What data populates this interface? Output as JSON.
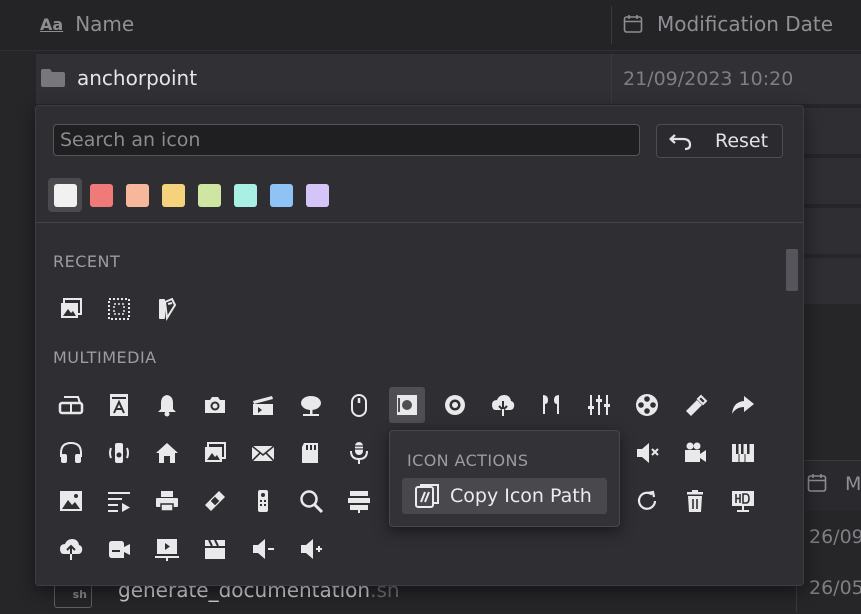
{
  "table": {
    "col_name": "Name",
    "col_date": "Modification Date",
    "name_icon_glyph": "Aa",
    "rows": [
      {
        "name": "anchorpoint",
        "date": "21/09/2023 10:20"
      }
    ],
    "side_header_letter": "M",
    "side_dates": [
      "26/09",
      "26/05"
    ],
    "bottom_file": {
      "name": "generate_documentation",
      "ext": ".sh",
      "badge": "sh"
    }
  },
  "picker": {
    "search_placeholder": "Search an icon",
    "reset_label": "Reset",
    "colors": [
      "#f1f1f1",
      "#f07a7a",
      "#f6b79a",
      "#f5d27c",
      "#cfe6a2",
      "#a9efe4",
      "#8fc3f5",
      "#d5c4f7"
    ],
    "selected_color_index": 0,
    "recent_label": "RECENT",
    "multimedia_label": "MULTIMEDIA",
    "recent_icons": [
      "image-stack-icon",
      "dotted-square-icon",
      "swatch-book-icon"
    ],
    "multimedia_rows": [
      [
        "vr-glasses-icon",
        "font-file-icon",
        "bell-icon",
        "camera-icon",
        "clapperboard-icon",
        "tree-icon",
        "mouse-icon",
        "photo-frame-icon",
        "disc-icon",
        "cloud-download-icon",
        "airpods-icon",
        "equalizer-icon",
        "film-reel-icon",
        "usb-stick-icon",
        "share-arrow-icon"
      ],
      [
        "headphones-icon",
        "speaker-icon",
        "home-icon",
        "image-stack-icon",
        "mail-icon",
        "sd-card-icon",
        "microphone-icon",
        "",
        "",
        "",
        "",
        "",
        "mute-icon",
        "video-camera-icon",
        "piano-icon"
      ],
      [
        "image-icon",
        "playlist-icon",
        "printer-icon",
        "bandage-icon",
        "remote-icon",
        "search-icon",
        "server-icon",
        "",
        "",
        "",
        "",
        "",
        "refresh-icon",
        "trash-icon",
        "hd-monitor-icon"
      ],
      [
        "cloud-upload-icon",
        "camcorder-icon",
        "presentation-icon",
        "clapperboard-alt-icon",
        "volume-down-icon",
        "volume-up-icon"
      ]
    ]
  },
  "context_menu": {
    "title": "ICON ACTIONS",
    "items": [
      {
        "label": "Copy Icon Path",
        "icon": "copy-path-icon"
      }
    ]
  }
}
